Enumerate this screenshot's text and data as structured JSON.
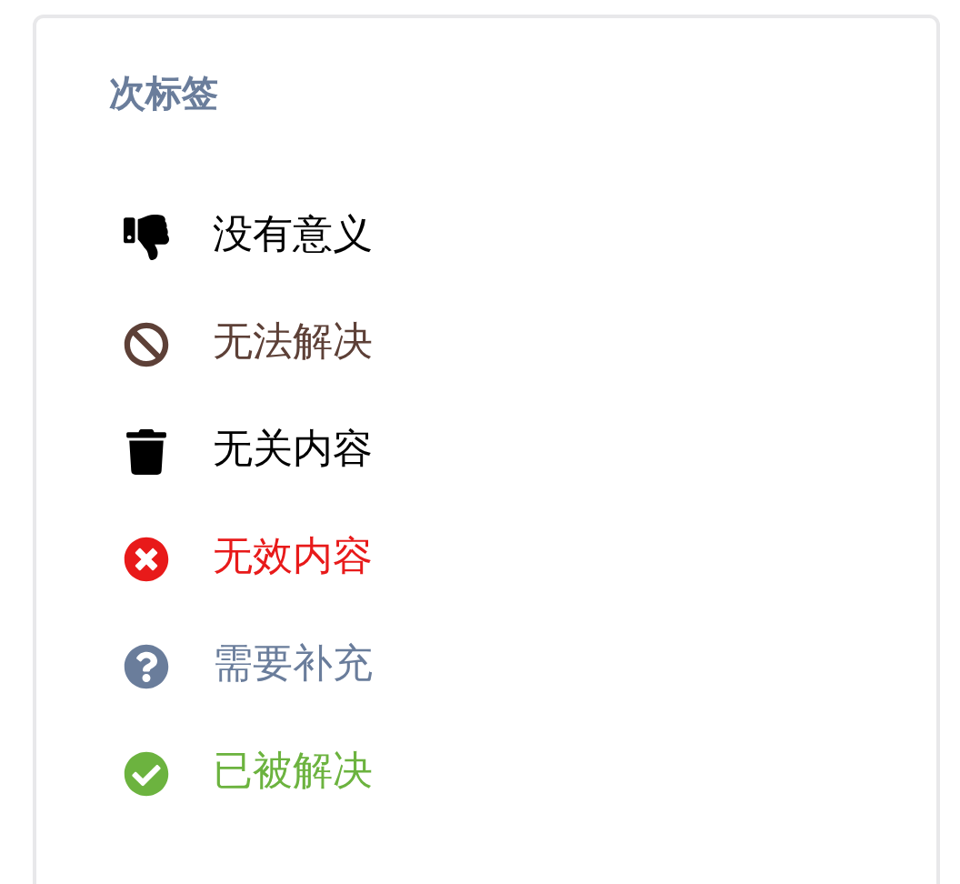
{
  "card": {
    "title": "次标签",
    "tags": [
      {
        "kind": "thumbs-down",
        "label": "没有意义",
        "color": "#000000"
      },
      {
        "kind": "ban",
        "label": "无法解决",
        "color": "#5d4037"
      },
      {
        "kind": "trash",
        "label": "无关内容",
        "color": "#000000"
      },
      {
        "kind": "error",
        "label": "无效内容",
        "color": "#e81a1a"
      },
      {
        "kind": "question",
        "label": "需要补充",
        "color": "#6a7d9b"
      },
      {
        "kind": "resolved",
        "label": "已被解决",
        "color": "#6cb33f"
      }
    ]
  }
}
